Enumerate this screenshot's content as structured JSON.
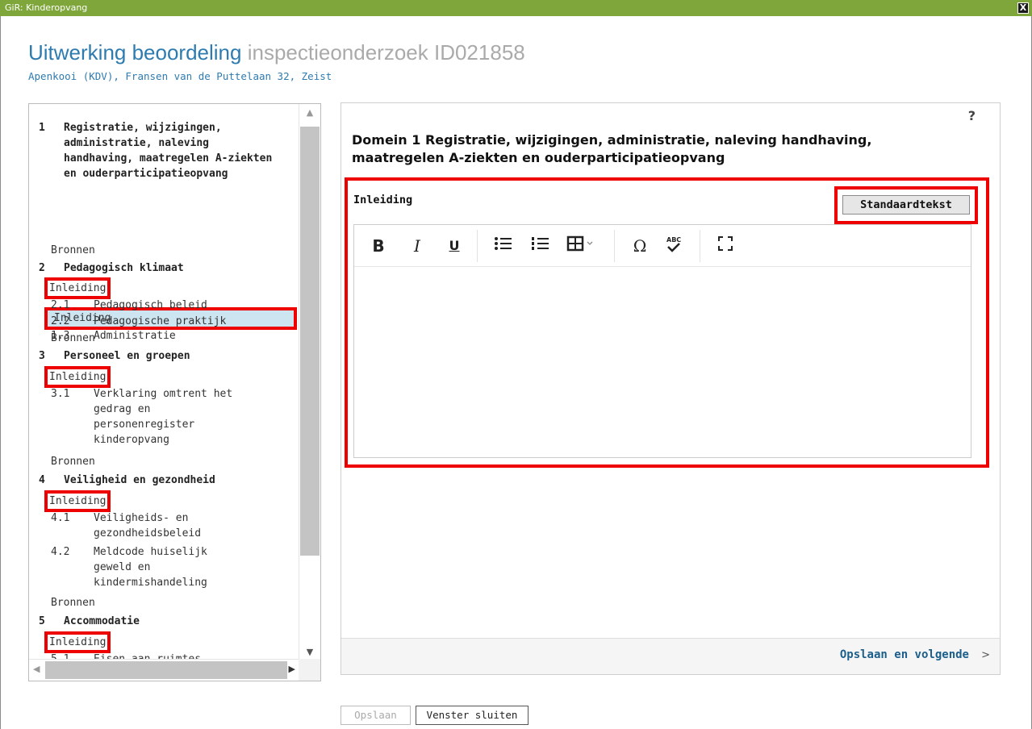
{
  "window": {
    "title": "GiR: Kinderopvang",
    "close_glyph": "X"
  },
  "header": {
    "title_main": "Uitwerking beoordeling",
    "title_sub": "inspectieonderzoek ID021858",
    "location": "Apenkooi (KDV), Fransen van de Puttelaan 32, Zeist"
  },
  "tree": {
    "sec1": {
      "num": "1",
      "label": "Registratie, wijzigingen, administratie, naleving handhaving, maatregelen A-ziekten en ouderparticipatieopvang",
      "intro": "Inleiding",
      "sub1_num": "1.3",
      "sub1_label": "Administratie",
      "sources": "Bronnen"
    },
    "sec2": {
      "num": "2",
      "label": "Pedagogisch klimaat",
      "intro": "Inleiding",
      "sub1_num": "2.1",
      "sub1_label": "Pedagogisch beleid",
      "sub2_num": "2.2",
      "sub2_label": "Pedagogische praktijk",
      "sources": "Bronnen"
    },
    "sec3": {
      "num": "3",
      "label": "Personeel en groepen",
      "intro": "Inleiding",
      "sub1_num": "3.1",
      "sub1_label": "Verklaring omtrent het gedrag en personenregister kinderopvang",
      "sources": "Bronnen"
    },
    "sec4": {
      "num": "4",
      "label": "Veiligheid en gezondheid",
      "intro": "Inleiding",
      "sub1_num": "4.1",
      "sub1_label": "Veiligheids- en gezondheidsbeleid",
      "sub2_num": "4.2",
      "sub2_label": "Meldcode huiselijk geweld en kindermishandeling",
      "sources": "Bronnen"
    },
    "sec5": {
      "num": "5",
      "label": "Accommodatie",
      "intro": "Inleiding",
      "sub1_num": "5.1",
      "sub1_label": "Eisen aan ruimtes"
    }
  },
  "main": {
    "help": "?",
    "domain_title": "Domein 1 Registratie, wijzigingen, administratie, naleving handhaving, maatregelen A-ziekten en ouderparticipatieopvang",
    "section_label": "Inleiding",
    "standard_text_button": "Standaardtekst",
    "toolbar": {
      "bold": "B",
      "italic": "I",
      "underline": "U",
      "bullets": "bulleted-list-icon",
      "numbers": "numbered-list-icon",
      "table": "table-icon",
      "special": "Ω",
      "spell": "spellcheck-icon",
      "fullscreen": "fullscreen-icon"
    },
    "editor_value": "",
    "next_label": "Opslaan en volgende",
    "next_arrow": ">"
  },
  "footer": {
    "save": "Opslaan",
    "close": "Venster sluiten"
  },
  "colors": {
    "titlebar": "#7fa63a",
    "title_blue": "#2e7bb0",
    "highlight": "#e00000",
    "selected_bg": "#cde4f1"
  }
}
